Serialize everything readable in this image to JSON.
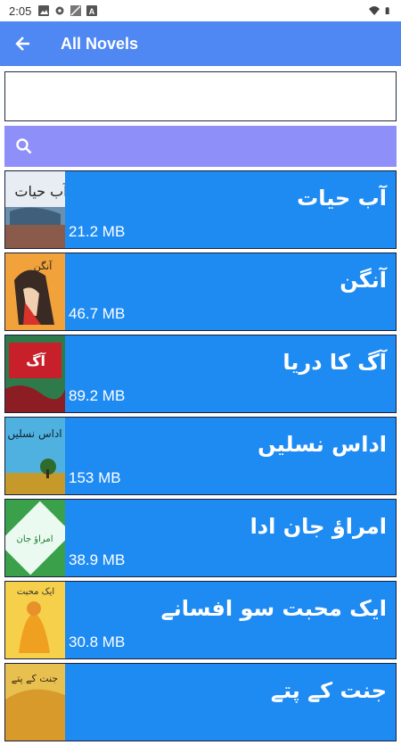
{
  "status_bar": {
    "time": "2:05",
    "left_icons": [
      "image-icon",
      "gear-icon",
      "signal-off-icon",
      "a-icon"
    ],
    "right_icons": [
      "wifi-icon",
      "battery-icon"
    ]
  },
  "app_bar": {
    "back_icon": "arrow-left-icon",
    "title": "All Novels",
    "color": "#4f88f2"
  },
  "input": {
    "value": "",
    "placeholder": ""
  },
  "search": {
    "icon": "search-icon",
    "color": "#8e8ff9"
  },
  "novels": [
    {
      "title": "آب حیات",
      "size": "21.2 MB",
      "cover_icon": "book-cover-icon"
    },
    {
      "title": "آنگن",
      "size": "46.7 MB",
      "cover_icon": "book-cover-icon"
    },
    {
      "title": "آگ کا دریا",
      "size": "89.2 MB",
      "cover_icon": "book-cover-icon"
    },
    {
      "title": "اداس نسلیں",
      "size": "153 MB",
      "cover_icon": "book-cover-icon"
    },
    {
      "title": "امراؤ جان ادا",
      "size": "38.9 MB",
      "cover_icon": "book-cover-icon"
    },
    {
      "title": "ایک محبت سو افسانے",
      "size": "30.8 MB",
      "cover_icon": "book-cover-icon"
    },
    {
      "title": "جنت کے پتے",
      "size": "",
      "cover_icon": "book-cover-icon"
    }
  ],
  "colors": {
    "row_bg": "#1e8bf3",
    "row_border": "#1a1f3a",
    "text": "#ffffff"
  }
}
